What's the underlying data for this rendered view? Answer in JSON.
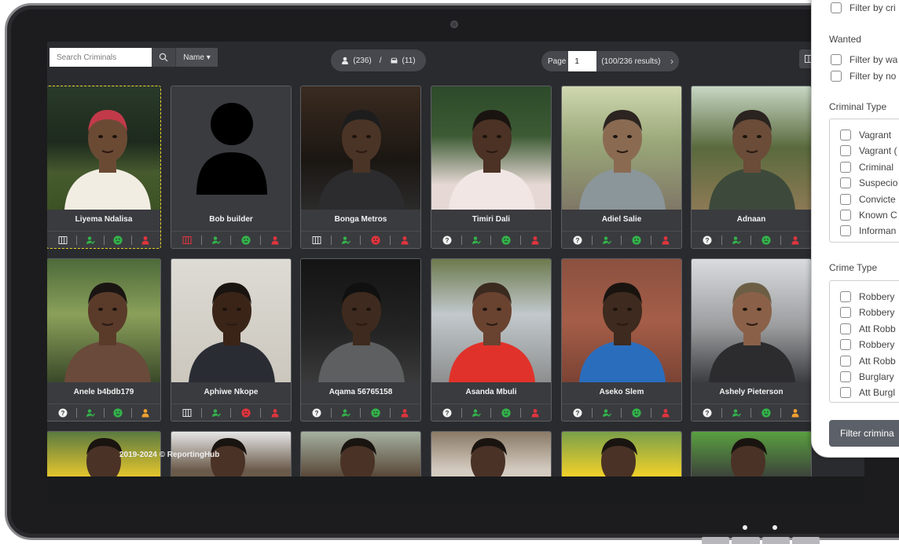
{
  "search": {
    "placeholder": "Search Criminals",
    "sort_label": "Name ▾"
  },
  "counts": {
    "persons": "(236)",
    "separator": "/",
    "vehicles": "(11)"
  },
  "pagination": {
    "label": "Page",
    "value": "1",
    "results": "(100/236 results)"
  },
  "colors": {
    "green": "#33b24a",
    "red": "#e0343d",
    "orange": "#f0a030",
    "selected_border": "#e6d52b"
  },
  "cards": [
    {
      "name": "Liyema Ndalisa",
      "status_icon": "columns-icon",
      "face": "green-smile-icon",
      "person": "red"
    },
    {
      "name": "Bob builder",
      "status_icon": "columns-red-icon",
      "face": "green-smile-icon",
      "person": "red"
    },
    {
      "name": "Bonga Metros",
      "status_icon": "columns-icon",
      "face": "red-frown-icon",
      "person": "red"
    },
    {
      "name": "Timiri Dali",
      "status_icon": "question-icon",
      "face": "green-smile-icon",
      "person": "red"
    },
    {
      "name": "Adiel Salie",
      "status_icon": "question-icon",
      "face": "green-smile-icon",
      "person": "red"
    },
    {
      "name": "Adnaan",
      "status_icon": "question-icon",
      "face": "green-smile-icon",
      "person": "red"
    },
    {
      "name": "Anele b4bdb179",
      "status_icon": "question-icon",
      "face": "green-smile-icon",
      "person": "orange"
    },
    {
      "name": "Aphiwe Nkope",
      "status_icon": "columns-icon",
      "face": "red-frown-icon",
      "person": "red"
    },
    {
      "name": "Aqama 56765158",
      "status_icon": "question-icon",
      "face": "green-smile-icon",
      "person": "red"
    },
    {
      "name": "Asanda Mbuli",
      "status_icon": "question-icon",
      "face": "green-smile-icon",
      "person": "red"
    },
    {
      "name": "Aseko Slem",
      "status_icon": "question-icon",
      "face": "green-smile-icon",
      "person": "red"
    },
    {
      "name": "Ashely Pieterson",
      "status_icon": "question-icon",
      "face": "green-smile-icon",
      "person": "orange"
    }
  ],
  "footer": {
    "text": "2019-2024 © ReportingHub"
  },
  "filters": {
    "top_partial": "Filter by cri",
    "wanted_heading": "Wanted",
    "wanted_options": [
      "Filter by wa",
      "Filter by no"
    ],
    "criminal_type_heading": "Criminal Type",
    "criminal_types": [
      "Vagrant",
      "Vagrant (",
      "Criminal",
      "Suspecio",
      "Convicte",
      "Known C",
      "Informan"
    ],
    "crime_type_heading": "Crime Type",
    "crime_types": [
      "Robbery",
      "Robbery",
      "Att Robb",
      "Robbery",
      "Att Robb",
      "Burglary",
      "Att Burgl"
    ],
    "submit_label": "Filter crimina"
  }
}
